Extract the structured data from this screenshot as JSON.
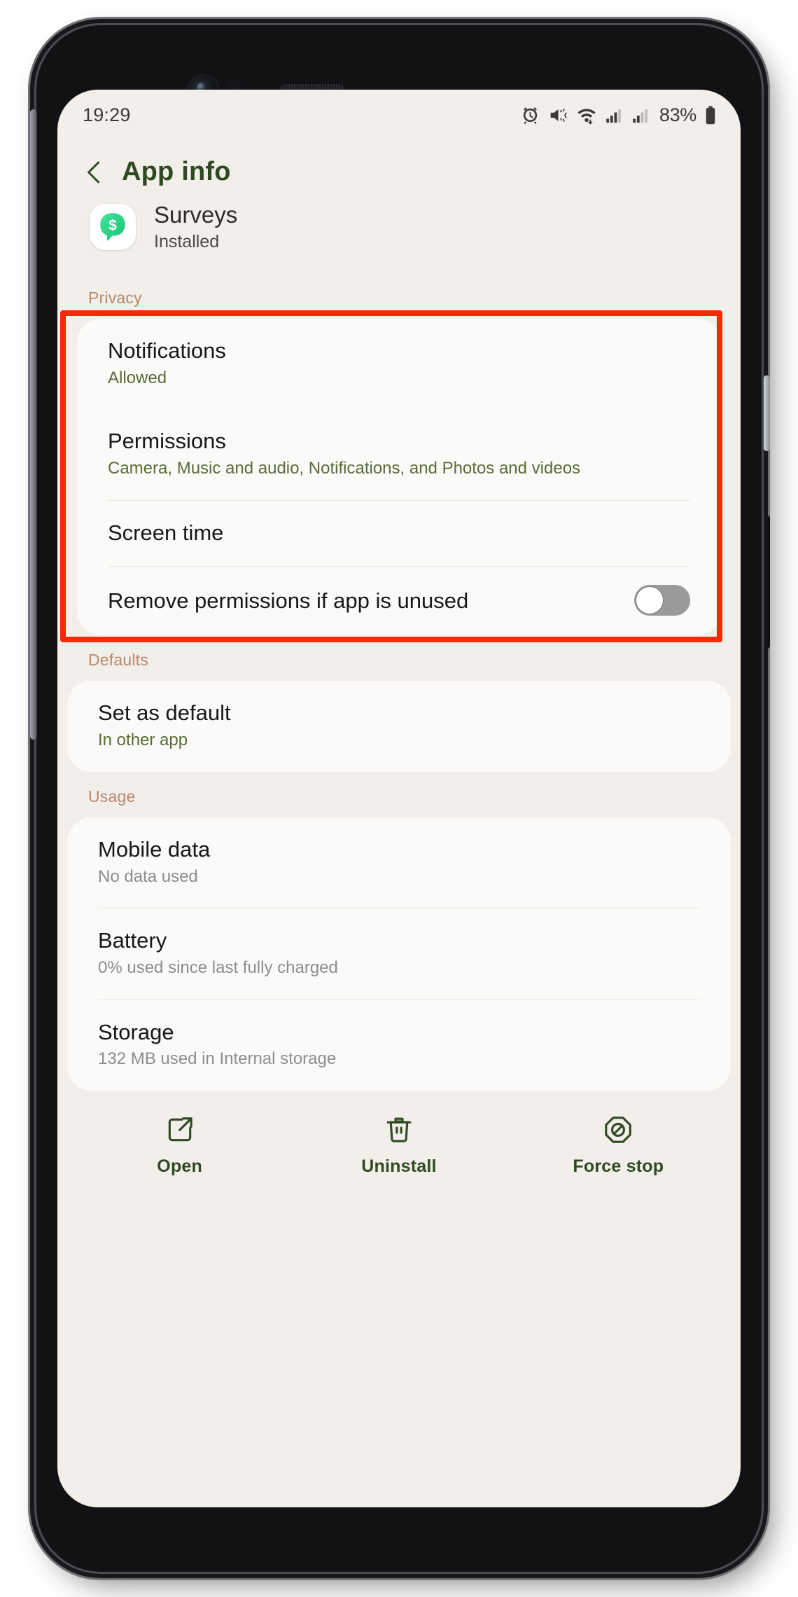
{
  "status_bar": {
    "time": "19:29",
    "battery_percent": "83%",
    "icons": [
      "alarm-icon",
      "mute-vibrate-icon",
      "wifi-icon",
      "signal-sim1-icon",
      "signal-sim2-icon",
      "battery-icon"
    ]
  },
  "header": {
    "back_icon": "back-chevron-icon",
    "title": "App info"
  },
  "app": {
    "icon": "surveys-app-icon",
    "name": "Surveys",
    "status": "Installed"
  },
  "sections": [
    {
      "label": "Privacy",
      "rows": [
        {
          "title": "Notifications",
          "subtitle": "Allowed",
          "subtitle_style": "olive",
          "highlighted": true
        },
        {
          "title": "Permissions",
          "subtitle": "Camera, Music and audio, Notifications, and Photos and videos",
          "subtitle_style": "olive"
        },
        {
          "title": "Screen time",
          "subtitle": ""
        },
        {
          "title": "Remove permissions if app is unused",
          "subtitle": "",
          "toggle": "off"
        }
      ]
    },
    {
      "label": "Defaults",
      "rows": [
        {
          "title": "Set as default",
          "subtitle": "In other app",
          "subtitle_style": "olive"
        }
      ]
    },
    {
      "label": "Usage",
      "rows": [
        {
          "title": "Mobile data",
          "subtitle": "No data used",
          "subtitle_style": "grey"
        },
        {
          "title": "Battery",
          "subtitle": "0% used since last fully charged",
          "subtitle_style": "grey"
        },
        {
          "title": "Storage",
          "subtitle": "132 MB used in Internal storage",
          "subtitle_style": "grey"
        }
      ]
    }
  ],
  "bottom_bar": {
    "items": [
      {
        "icon": "open-external-icon",
        "label": "Open"
      },
      {
        "icon": "trash-icon",
        "label": "Uninstall"
      },
      {
        "icon": "force-stop-icon",
        "label": "Force stop"
      }
    ]
  },
  "colors": {
    "accent_green": "#2f4a22",
    "section_label": "#b58a6d",
    "highlight_red": "#f52b06",
    "screen_bg": "#f2eeea",
    "card_bg": "#fbfaf8",
    "app_icon_green": "#2fd48b"
  }
}
